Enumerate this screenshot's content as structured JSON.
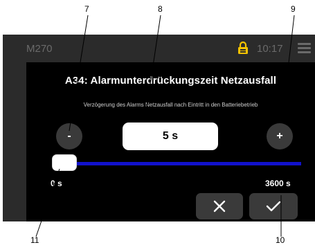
{
  "topbar": {
    "model": "M270",
    "clock": "10:17",
    "lock_icon": "lock-icon",
    "menu_icon": "hamburger-menu-icon"
  },
  "dialog": {
    "title": "A34: Alarmunterdrückungszeit Netzausfall",
    "subtitle": "Verzögerung des Alarms Netzausfall nach Eintritt in den Batteriebetrieb",
    "minus_label": "-",
    "plus_label": "+",
    "value": "5 s",
    "slider": {
      "min_label": "0 s",
      "max_label": "3600 s",
      "min": 0,
      "max": 3600,
      "current": 5
    },
    "cancel_icon": "close-icon",
    "confirm_icon": "checkmark-icon"
  },
  "callouts": [
    "7",
    "8",
    "9",
    "10",
    "11"
  ],
  "colors": {
    "device_bg": "#2b2b2b",
    "dialog_bg": "#000000",
    "slider_track": "#1111cc",
    "lock_yellow": "#f2c200",
    "button_bg": "#3a3a3a"
  }
}
